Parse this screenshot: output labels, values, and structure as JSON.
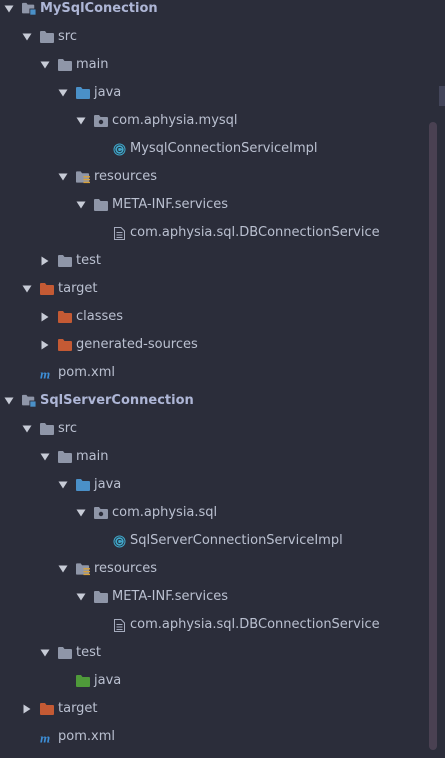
{
  "colors": {
    "background": "#2b2d3a",
    "text": "#bac0d0",
    "folder_gray": "#8f96a8",
    "folder_blue": "#4a90c8",
    "folder_orange": "#c45a34",
    "folder_green": "#4f9a3a",
    "maven_blue": "#3d8fd8",
    "class_cyan": "#41a6c9",
    "arrow": "#c7cbd6",
    "scrollbar": "#4a4152"
  },
  "tree": [
    {
      "level": 1,
      "arrow": "down",
      "icon": "module-folder-icon",
      "label": "MySqlConection",
      "bold": true,
      "name": "tree-item-mysqlconection"
    },
    {
      "level": 2,
      "arrow": "down",
      "icon": "folder-icon",
      "label": "src",
      "name": "tree-item-src"
    },
    {
      "level": 3,
      "arrow": "down",
      "icon": "folder-icon",
      "label": "main",
      "name": "tree-item-main"
    },
    {
      "level": 4,
      "arrow": "down",
      "icon": "source-folder-icon",
      "label": "java",
      "name": "tree-item-java"
    },
    {
      "level": 5,
      "arrow": "down",
      "icon": "package-icon",
      "label": "com.aphysia.mysql",
      "name": "tree-item-package-mysql"
    },
    {
      "level": 6,
      "arrow": "none",
      "icon": "class-icon",
      "label": "MysqlConnectionServiceImpl",
      "name": "tree-item-mysql-impl-class"
    },
    {
      "level": 4,
      "arrow": "down",
      "icon": "resources-folder-icon",
      "label": "resources",
      "name": "tree-item-resources"
    },
    {
      "level": 5,
      "arrow": "down",
      "icon": "folder-icon",
      "label": "META-INF.services",
      "name": "tree-item-meta-inf-services"
    },
    {
      "level": 6,
      "arrow": "none",
      "icon": "file-icon",
      "label": "com.aphysia.sql.DBConnectionService",
      "name": "tree-item-service-file"
    },
    {
      "level": 3,
      "arrow": "right",
      "icon": "folder-icon",
      "label": "test",
      "name": "tree-item-test"
    },
    {
      "level": 2,
      "arrow": "down",
      "icon": "orange-folder-icon",
      "label": "target",
      "name": "tree-item-target"
    },
    {
      "level": 3,
      "arrow": "right",
      "icon": "orange-folder-icon",
      "label": "classes",
      "name": "tree-item-classes"
    },
    {
      "level": 3,
      "arrow": "right",
      "icon": "orange-folder-icon",
      "label": "generated-sources",
      "name": "tree-item-generated-sources"
    },
    {
      "level": 2,
      "arrow": "none",
      "icon": "maven-icon",
      "label": "pom.xml",
      "name": "tree-item-pom-xml"
    },
    {
      "level": 1,
      "arrow": "down",
      "icon": "module-folder-icon",
      "label": "SqlServerConnection",
      "bold": true,
      "name": "tree-item-sqlserverconnection"
    },
    {
      "level": 2,
      "arrow": "down",
      "icon": "folder-icon",
      "label": "src",
      "name": "tree-item-src"
    },
    {
      "level": 3,
      "arrow": "down",
      "icon": "folder-icon",
      "label": "main",
      "name": "tree-item-main"
    },
    {
      "level": 4,
      "arrow": "down",
      "icon": "source-folder-icon",
      "label": "java",
      "name": "tree-item-java"
    },
    {
      "level": 5,
      "arrow": "down",
      "icon": "package-icon",
      "label": "com.aphysia.sql",
      "name": "tree-item-package-sql"
    },
    {
      "level": 6,
      "arrow": "none",
      "icon": "class-icon",
      "label": "SqlServerConnectionServiceImpl",
      "name": "tree-item-sqlserver-impl-class"
    },
    {
      "level": 4,
      "arrow": "down",
      "icon": "resources-folder-icon",
      "label": "resources",
      "name": "tree-item-resources"
    },
    {
      "level": 5,
      "arrow": "down",
      "icon": "folder-icon",
      "label": "META-INF.services",
      "name": "tree-item-meta-inf-services"
    },
    {
      "level": 6,
      "arrow": "none",
      "icon": "file-icon",
      "label": "com.aphysia.sql.DBConnectionService",
      "name": "tree-item-service-file"
    },
    {
      "level": 3,
      "arrow": "down",
      "icon": "folder-icon",
      "label": "test",
      "name": "tree-item-test"
    },
    {
      "level": 4,
      "arrow": "none",
      "icon": "test-source-folder-icon",
      "label": "java",
      "name": "tree-item-test-java"
    },
    {
      "level": 2,
      "arrow": "right",
      "icon": "orange-folder-icon",
      "label": "target",
      "name": "tree-item-target"
    },
    {
      "level": 2,
      "arrow": "none",
      "icon": "maven-icon",
      "label": "pom.xml",
      "name": "tree-item-pom-xml"
    }
  ]
}
